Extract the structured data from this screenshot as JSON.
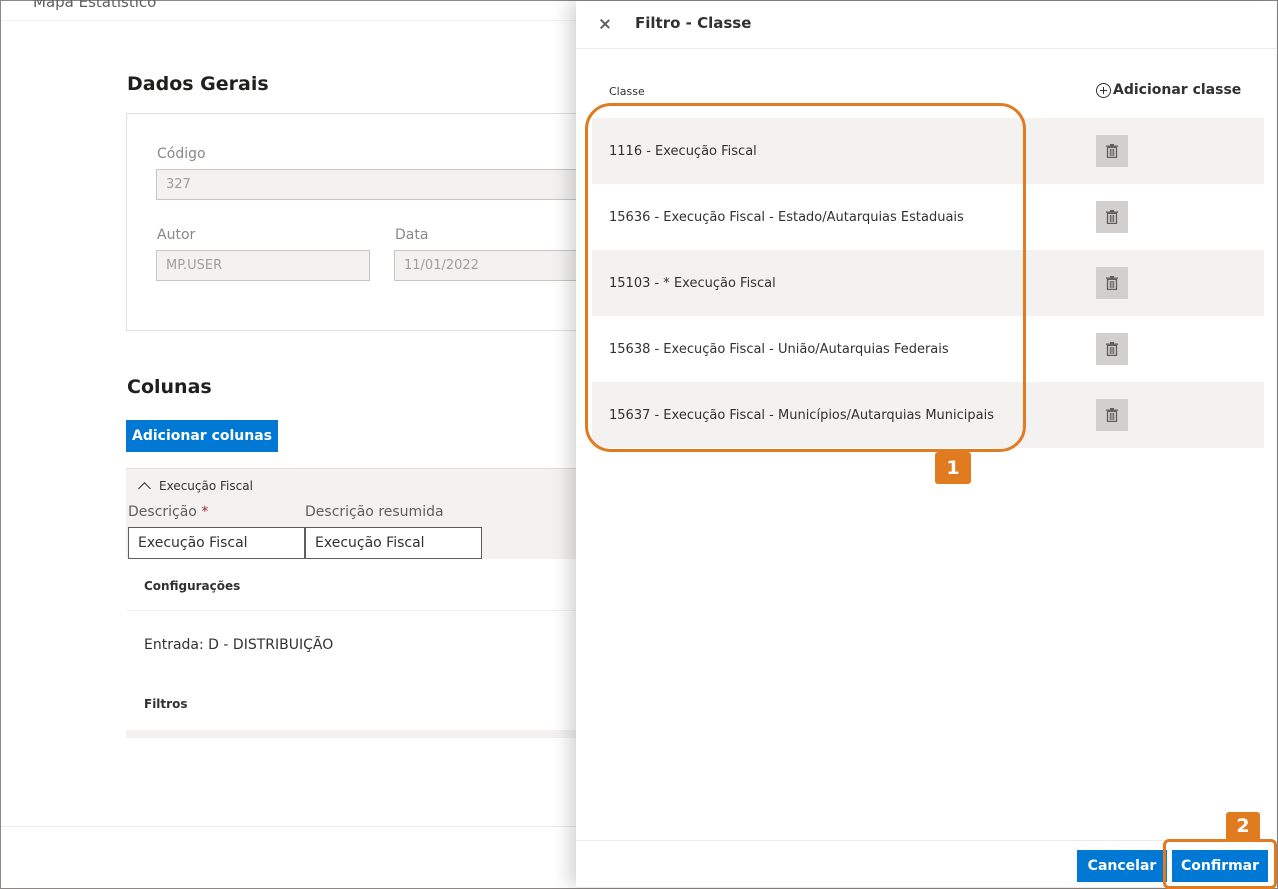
{
  "page": {
    "title": "Mapa Estatístico",
    "dados_gerais": {
      "title": "Dados Gerais",
      "codigo_label": "Código",
      "codigo_value": "327",
      "autor_label": "Autor",
      "autor_value": "MP.USER",
      "data_label": "Data",
      "data_value": "11/01/2022"
    },
    "colunas": {
      "title": "Colunas",
      "add_button": "Adicionar colunas",
      "group_title": "Execução Fiscal",
      "descricao_label": "Descrição",
      "required_mark": "*",
      "descricao_value": "Execução Fiscal",
      "descricao_resumida_label": "Descrição resumida",
      "descricao_resumida_value": "Execução Fiscal",
      "configuracoes_title": "Configurações",
      "entrada_text": "Entrada: D - DISTRIBUIÇÃO",
      "filtros_title": "Filtros"
    }
  },
  "panel": {
    "title": "Filtro - Classe",
    "column_header": "Classe",
    "add_label": "Adicionar classe",
    "rows": [
      {
        "label": "1116 - Execução Fiscal"
      },
      {
        "label": "15636 - Execução Fiscal - Estado/Autarquias Estaduais"
      },
      {
        "label": "15103 - * Execução Fiscal"
      },
      {
        "label": "15638 - Execução Fiscal - União/Autarquias Federais"
      },
      {
        "label": "15637 - Execução Fiscal - Municípios/Autarquias Municipais"
      }
    ],
    "cancel_label": "Cancelar",
    "confirm_label": "Confirmar"
  },
  "annotations": {
    "badge_1": "1",
    "badge_2": "2",
    "color": "#e07b1f"
  },
  "colors": {
    "primary": "#0078d4",
    "row_alt": "#f3f2f1",
    "trash_bg": "#d2d0ce"
  },
  "icons": {
    "close": "close-icon",
    "add": "add-circle-icon",
    "delete": "trash-icon",
    "collapse": "chevron-up-icon"
  }
}
